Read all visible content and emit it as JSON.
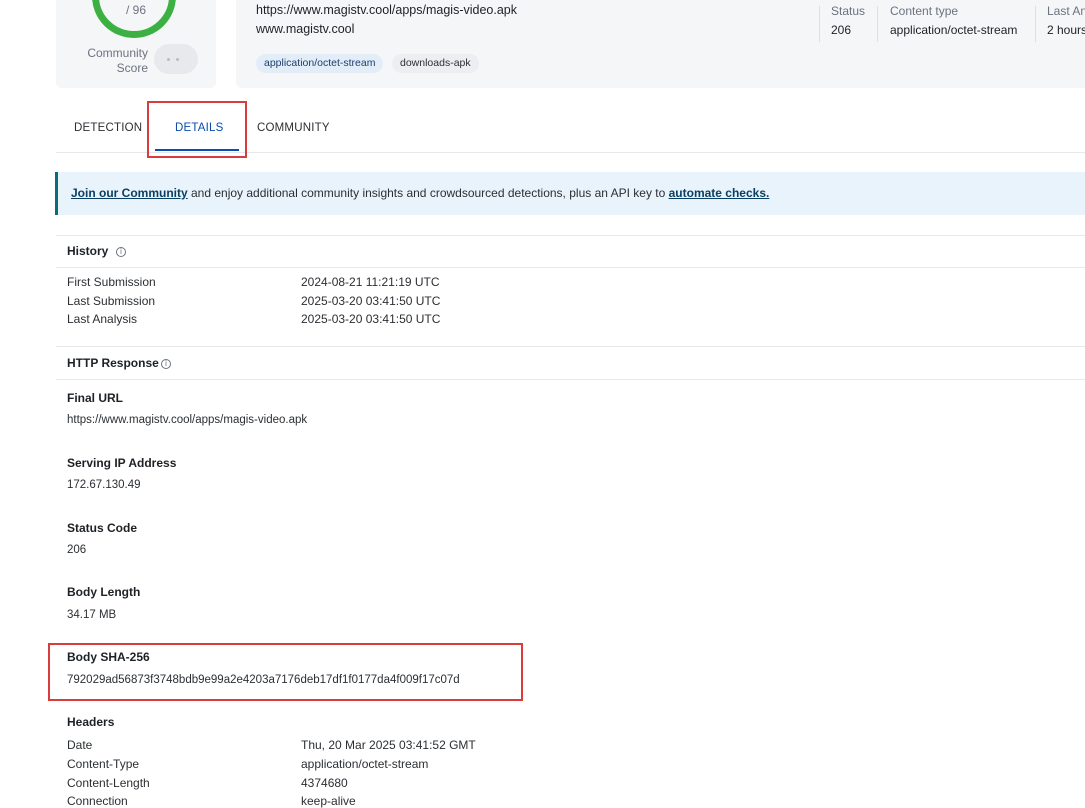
{
  "score": {
    "total": "/ 96",
    "label": "Community Score",
    "label_line1": "Community",
    "label_line2": "Score",
    "ring_color": "#3cb043"
  },
  "summary": {
    "url": "https://www.magistv.cool/apps/magis-video.apk",
    "domain": "www.magistv.cool",
    "tags": [
      "application/octet-stream",
      "downloads-apk"
    ],
    "meta": [
      {
        "label": "Status",
        "value": "206"
      },
      {
        "label": "Content type",
        "value": "application/octet-stream"
      },
      {
        "label": "Last An",
        "value": "2 hours"
      }
    ]
  },
  "tabs": [
    {
      "label": "DETECTION",
      "active": false
    },
    {
      "label": "DETAILS",
      "active": true
    },
    {
      "label": "COMMUNITY",
      "active": false
    }
  ],
  "banner": {
    "link1": "Join our Community",
    "middle": " and enjoy additional community insights and crowdsourced detections, plus an API key to ",
    "link2": "automate checks."
  },
  "history": {
    "title": "History",
    "rows": [
      {
        "key": "First Submission",
        "value": "2024-08-21 11:21:19 UTC"
      },
      {
        "key": "Last Submission",
        "value": "2025-03-20 03:41:50 UTC"
      },
      {
        "key": "Last Analysis",
        "value": "2025-03-20 03:41:50 UTC"
      }
    ]
  },
  "http_response": {
    "title": "HTTP Response",
    "fields": [
      {
        "label": "Final URL",
        "value": "https://www.magistv.cool/apps/magis-video.apk"
      },
      {
        "label": "Serving IP Address",
        "value": "172.67.130.49"
      },
      {
        "label": "Status Code",
        "value": "206"
      },
      {
        "label": "Body Length",
        "value": "34.17 MB"
      },
      {
        "label": "Body SHA-256",
        "value": "792029ad56873f3748bdb9e99a2e4203a7176deb17df1f0177da4f009f17c07d"
      }
    ],
    "headers_title": "Headers",
    "headers": [
      {
        "key": "Date",
        "value": "Thu, 20 Mar 2025 03:41:52 GMT"
      },
      {
        "key": "Content-Type",
        "value": "application/octet-stream"
      },
      {
        "key": "Content-Length",
        "value": "4374680"
      },
      {
        "key": "Connection",
        "value": "keep-alive"
      }
    ]
  },
  "colors": {
    "accent": "#0b4dab",
    "highlight": "#d93c3c",
    "banner_border": "#0a6b7a"
  }
}
